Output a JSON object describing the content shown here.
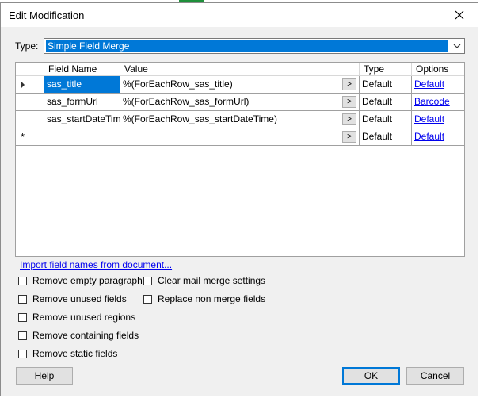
{
  "window": {
    "title": "Edit Modification"
  },
  "type": {
    "label": "Type:",
    "value": "Simple Field Merge"
  },
  "grid": {
    "headers": [
      "Field Name",
      "Value",
      "Type",
      "Options"
    ],
    "rows": [
      {
        "field": "sas_title",
        "value": "%(ForEachRow_sas_title)",
        "type": "Default",
        "option": "Default"
      },
      {
        "field": "sas_formUrl",
        "value": "%(ForEachRow_sas_formUrl)",
        "type": "Default",
        "option": "Barcode"
      },
      {
        "field": "sas_startDateTime",
        "value": "%(ForEachRow_sas_startDateTime)",
        "type": "Default",
        "option": "Default"
      },
      {
        "field": "",
        "value": "",
        "type": "Default",
        "option": "Default"
      }
    ],
    "new_row_marker": "*",
    "browse_label": ">"
  },
  "import_link": "Import field names from document...",
  "options_left": [
    "Remove empty paragraphs",
    "Remove unused fields",
    "Remove unused regions",
    "Remove containing fields",
    "Remove static fields"
  ],
  "options_right": [
    "Clear mail merge settings",
    "Replace non merge fields"
  ],
  "buttons": {
    "help": "Help",
    "ok": "OK",
    "cancel": "Cancel"
  }
}
